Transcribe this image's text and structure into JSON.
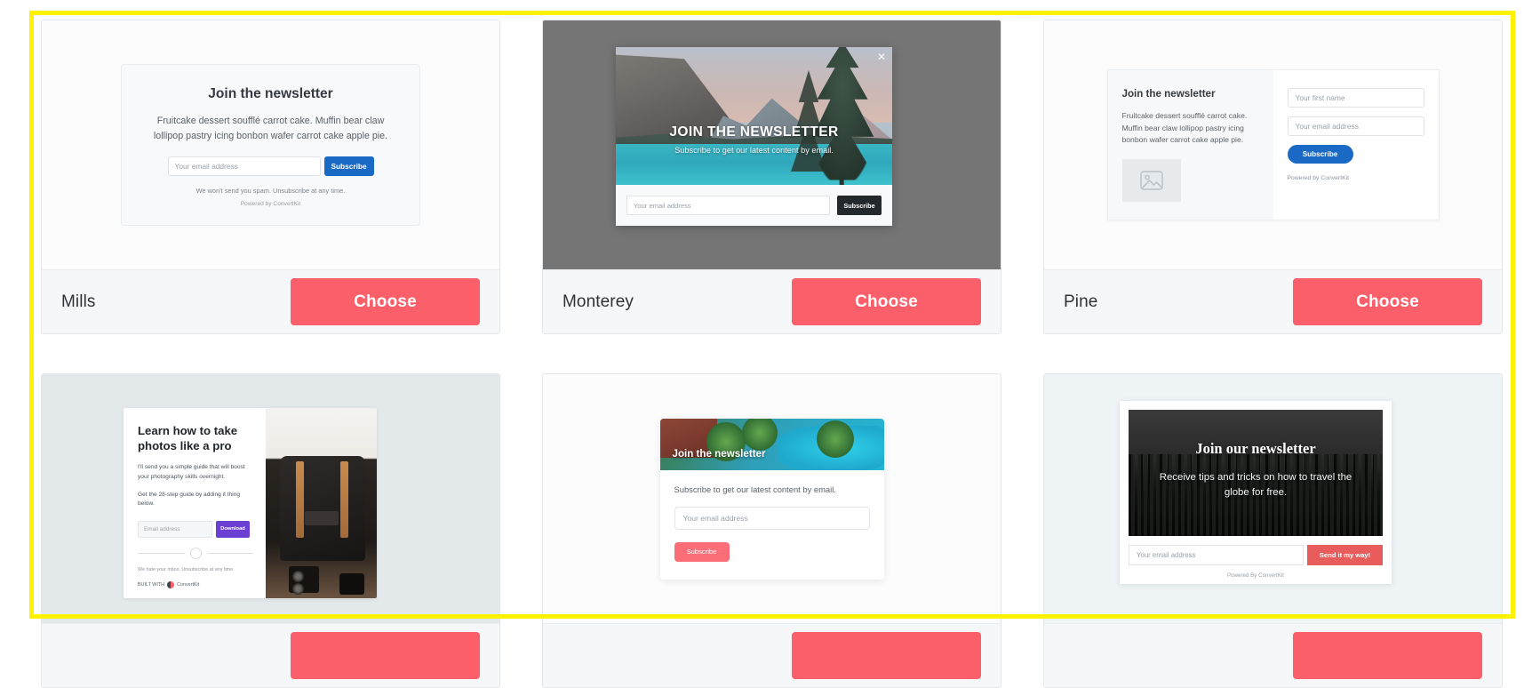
{
  "selection": {
    "color": "#fff200"
  },
  "theme": {
    "choose_button_color": "#fb5f6a",
    "card_bg": "#fcfcfd",
    "footer_bg": "#f5f7f9"
  },
  "templates": [
    {
      "name": "Mills",
      "choose_label": "Choose",
      "preview": {
        "style": "mills",
        "title": "Join the newsletter",
        "description": "Fruitcake dessert soufflé carrot cake. Muffin bear claw lollipop pastry icing bonbon wafer carrot cake apple pie.",
        "email_placeholder": "Your email address",
        "subscribe_label": "Subscribe",
        "disclaimer": "We won't send you spam. Unsubscribe at any time.",
        "powered_by": "Powered by ConvertKit"
      }
    },
    {
      "name": "Monterey",
      "choose_label": "Choose",
      "preview": {
        "style": "monterey",
        "title": "JOIN THE NEWSLETTER",
        "subtitle": "Subscribe to get our latest content by email.",
        "email_placeholder": "Your email address",
        "subscribe_label": "Subscribe",
        "close_glyph": "✕"
      }
    },
    {
      "name": "Pine",
      "choose_label": "Choose",
      "preview": {
        "style": "pine",
        "title": "Join the newsletter",
        "description": "Fruitcake dessert soufflé carrot cake. Muffin bear claw lollipop pastry icing bonbon wafer carrot cake apple pie.",
        "first_name_placeholder": "Your first name",
        "email_placeholder": "Your email address",
        "subscribe_label": "Subscribe",
        "powered_by": "Powered by ConvertKit",
        "image_placeholder_icon": "image-placeholder-icon"
      }
    },
    {
      "name": "",
      "choose_label": "",
      "preview": {
        "style": "photo-guide",
        "title": "Learn how to take photos like a pro",
        "paragraph1": "I'll send you a simple guide that will boost your photography skills overnight.",
        "paragraph2": "Get the 28-step guide by adding it thing below.",
        "email_placeholder": "Email address",
        "button_label": "Download",
        "disclaimer": "We hate your inbox. Unsubscribe at any time.",
        "brand": "BUILT WITH",
        "brand_name": "ConvertKit"
      }
    },
    {
      "name": "",
      "choose_label": "",
      "preview": {
        "style": "pool",
        "title": "Join the newsletter",
        "subtitle": "Subscribe to get our latest content by email.",
        "email_placeholder": "Your email address",
        "subscribe_label": "Subscribe"
      }
    },
    {
      "name": "",
      "choose_label": "",
      "preview": {
        "style": "forest",
        "title": "Join our newsletter",
        "subtitle": "Receive tips and tricks on how to travel the globe for free.",
        "email_placeholder": "Your email address",
        "button_label": "Send it my way!",
        "powered_by": "Powered By ConvertKit"
      }
    }
  ]
}
